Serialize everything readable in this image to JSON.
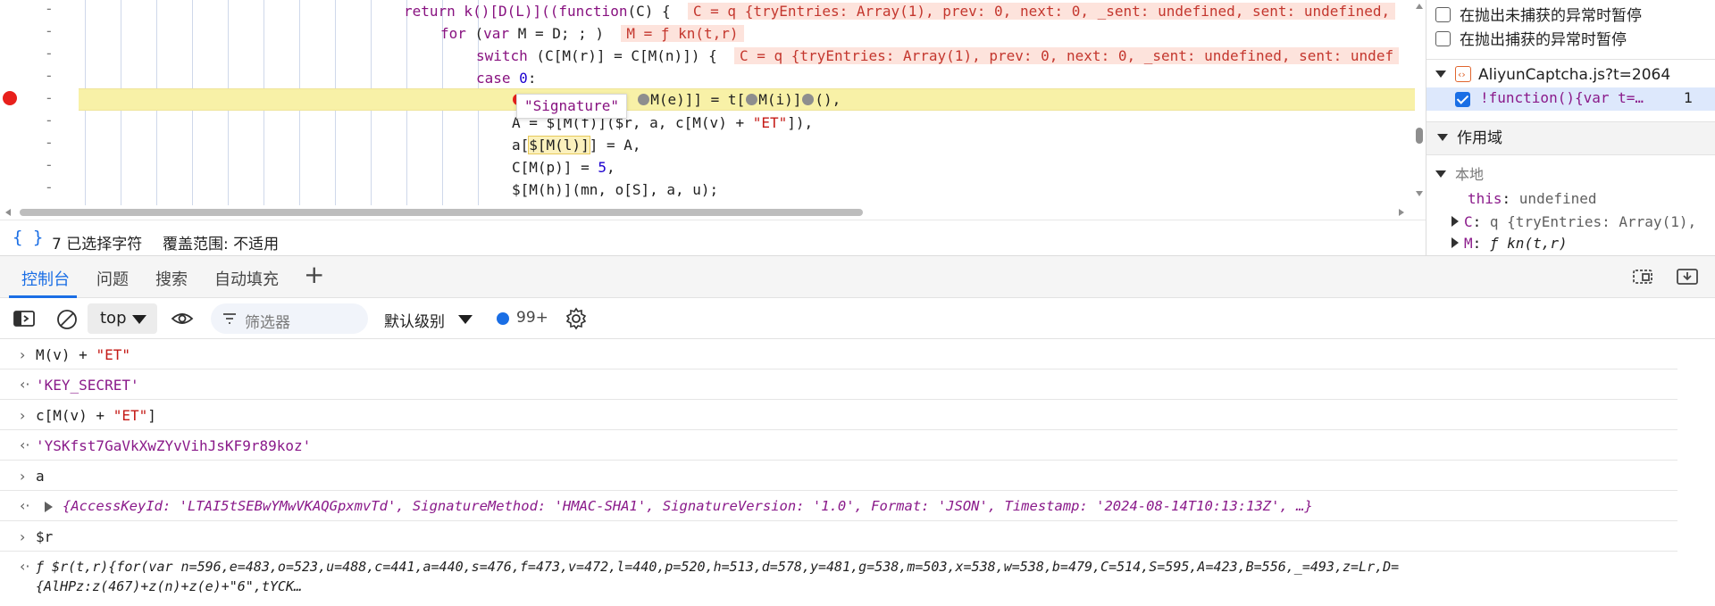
{
  "editor": {
    "breakpoint_color": "#e8201c",
    "lines": [
      {
        "gutter": "-"
      },
      {
        "gutter": "-"
      },
      {
        "gutter": "-"
      },
      {
        "gutter": "-"
      },
      {
        "gutter": "-"
      },
      {
        "gutter": "-"
      },
      {
        "gutter": "-"
      },
      {
        "gutter": "-"
      },
      {
        "gutter": "-"
      }
    ],
    "code": {
      "l1_a": "return k()[D(L)]((",
      "l1_kw": "function",
      "l1_b": "(C) {",
      "l1_inline": "C = q {tryEntries: Array(1), prev: 0, next: 0, _sent: undefined, sent: undefined,",
      "l2_kw1": "for",
      "l2_a": " (",
      "l2_kw2": "var",
      "l2_b": " M = D; ; )",
      "l2_inline": "M = ƒ kn(t,r)",
      "l3_kw": "switch",
      "l3_a": " (C[M(r)] = C[M(n)]) {",
      "l3_inline": "C = q {tryEntries: Array(1), prev: 0, next: 0, _sent: undefined, sent: undef",
      "l4_kw": "case",
      "l4_num": "0",
      "l4_b": ":",
      "l5_a": "M(e)]] = t[",
      "l5_b": "M(i)]",
      "l5_c": "(),",
      "l6_a": "A = $[M(f)]($r, a, c[M(v) + ",
      "l6_str": "\"ET\"",
      "l6_b": "]),",
      "l7_a": "a[",
      "l7_box": "$[M(l)]",
      "l7_b": "] = A,",
      "l8_a": "C[M(p)] = ",
      "l8_num": "5",
      "l8_b": ",",
      "l9_a": "$[M(h)](mn, o[S], a, u);"
    },
    "tooltip": "\"Signature\""
  },
  "statusbar": {
    "braces": "{ }",
    "selected": "7 已选择字符",
    "coverage": "覆盖范围: 不适用"
  },
  "sidebar": {
    "pause_uncaught": "在抛出未捕获的异常时暂停",
    "pause_caught": "在抛出捕获的异常时暂停",
    "file": "AliyunCaptcha.js?t=2064",
    "bp_code": "!function(){var t=…",
    "bp_line": "1",
    "scope_header": "作用域",
    "local_header": "本地",
    "this_key": "this",
    "this_val": "undefined",
    "c_key": "C",
    "c_val": "q {tryEntries: Array(1),",
    "m_key": "M",
    "m_val": "ƒ kn(t,r)"
  },
  "tabs": [
    "控制台",
    "问题",
    "搜索",
    "自动填充"
  ],
  "toolbar": {
    "context": "top",
    "filter_placeholder": "筛选器",
    "level": "默认级别",
    "issues_count": "99+"
  },
  "console": {
    "rows": [
      {
        "kind": "in",
        "a": "M(v) + ",
        "str": "\"ET\""
      },
      {
        "kind": "out",
        "text": "'KEY_SECRET'"
      },
      {
        "kind": "in",
        "a": "c[M(v) + ",
        "str": "\"ET\"",
        "b": "]"
      },
      {
        "kind": "out",
        "text": "'YSKfst7GaVkXwZYvVihJsKF9r89koz'"
      },
      {
        "kind": "in",
        "a": "a"
      },
      {
        "kind": "out",
        "text": "{AccessKeyId: 'LTAI5tSEBwYMwVKAQGpxmvTd', SignatureMethod: 'HMAC-SHA1', SignatureVersion: '1.0', Format: 'JSON', Timestamp: '2024-08-14T10:13:13Z', …}"
      },
      {
        "kind": "in",
        "a": "$r"
      },
      {
        "kind": "out",
        "text1": "ƒ $r(t,r){for(var n=596,e=483,o=523,u=488,c=441,a=440,s=476,f=473,v=472,l=440,p=520,h=513,d=578,y=481,g=538,m=503,x=538,w=538,b=479,C=514,S=595,A=423,B=556,_=493,z=Lr,D=",
        "text2": "{AlHPz:z(467)+z(n)+z(e)+\"6\",tYCK…"
      }
    ]
  }
}
